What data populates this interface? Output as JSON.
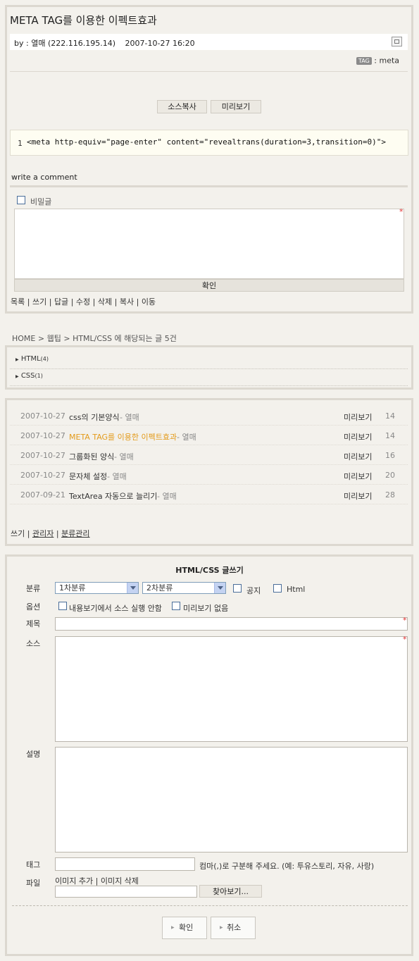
{
  "post": {
    "title": "META TAG를 이용한 이펙트효과",
    "by_label": "by :",
    "author": "열매",
    "ip": "(222.116.195.14)",
    "datetime": "2007-10-27 16:20",
    "tag_label": "TAG",
    "tag_value": ": meta"
  },
  "code": {
    "copy_button": "소스복사",
    "preview_button": "미리보기",
    "line_number": "1",
    "line": "<meta http-equiv=\"page-enter\" content=\"revealtrans(duration=3,transition=0)\">"
  },
  "comment": {
    "heading": "write a comment",
    "secret_label": "비밀글",
    "required_mark": "*",
    "submit_label": "확인"
  },
  "actions": {
    "list": "목록",
    "write": "쓰기",
    "reply": "답글",
    "edit": "수정",
    "delete": "삭제",
    "copy": "복사",
    "move": "이동",
    "sep": "|"
  },
  "breadcrumb": {
    "home": "HOME",
    "cat1": "웹팁",
    "cat2": "HTML/CSS",
    "suffix": "에 해당되는 글 5건",
    "arrow": ">"
  },
  "categories": [
    {
      "name": "HTML",
      "count": "(4)"
    },
    {
      "name": "CSS",
      "count": "(1)"
    }
  ],
  "posts": [
    {
      "date": "2007-10-27",
      "title": "css의 기본양식",
      "author": "열매",
      "preview": "미리보기",
      "hits": "14",
      "current": false
    },
    {
      "date": "2007-10-27",
      "title": "META TAG를 이용한 이펙트효과",
      "author": "열매",
      "preview": "미리보기",
      "hits": "14",
      "current": true
    },
    {
      "date": "2007-10-27",
      "title": "그룹화된 양식",
      "author": "열매",
      "preview": "미리보기",
      "hits": "16",
      "current": false
    },
    {
      "date": "2007-10-27",
      "title": "문자체 설정",
      "author": "열매",
      "preview": "미리보기",
      "hits": "20",
      "current": false
    },
    {
      "date": "2007-09-21",
      "title": "TextArea 자동으로 늘리기",
      "author": "열매",
      "preview": "미리보기",
      "hits": "28",
      "current": false
    }
  ],
  "list_links": {
    "write": "쓰기",
    "admin": "관리자",
    "category_admin": "분류관리",
    "sep": "|"
  },
  "write_form": {
    "title": "HTML/CSS 글쓰기",
    "category_label": "분류",
    "category1": "1차분류",
    "category2": "2차분류",
    "notice_label": "공지",
    "html_label": "Html",
    "option_label": "옵션",
    "option_no_exec": "내용보기에서 소스 실행 안함",
    "option_no_preview": "미리보기 없음",
    "subject_label": "제목",
    "source_label": "소스",
    "desc_label": "설명",
    "tag_label": "태그",
    "tag_hint": "컴마(,)로 구분해 주세요. (예: 투유스토리, 자유, 사랑)",
    "file_label": "파일",
    "image_add": "이미지 추가",
    "image_delete": "이미지 삭제",
    "browse_button": "찾아보기...",
    "confirm_button": "확인",
    "cancel_button": "취소",
    "required_mark": "*"
  },
  "colors": {
    "accent": "#e39b1b",
    "required": "#e03030",
    "border": "#dcd8d0"
  }
}
